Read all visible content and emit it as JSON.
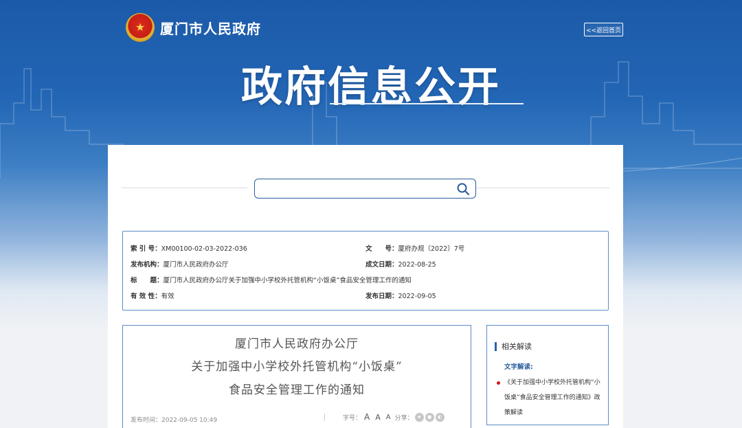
{
  "header": {
    "site_name": "厦门市人民政府",
    "home_link": "<<返回首页",
    "hero_title": "政府信息公开"
  },
  "search": {
    "value": "",
    "placeholder": ""
  },
  "meta": {
    "index_label": "索 引 号：",
    "index_value": "XM00100-02-03-2022-036",
    "doc_no_label": "文　　号：",
    "doc_no_value": "厦府办规〔2022〕7号",
    "issuer_label": "发布机构：",
    "issuer_value": "厦门市人民政府办公厅",
    "created_label": "成文日期：",
    "created_value": "2022-08-25",
    "title_label": "标　　题：",
    "title_value": "厦门市人民政府办公厅关于加强中小学校外托管机构“小饭桌”食品安全管理工作的通知",
    "validity_label": "有 效 性：",
    "validity_value": "有效",
    "published_label": "发布日期：",
    "published_value": "2022-09-05"
  },
  "article": {
    "title_line1": "厦门市人民政府办公厅",
    "title_line2": "关于加强中小学校外托管机构“小饭桌”",
    "title_line3": "食品安全管理工作的通知",
    "pubtime": "发布时间：2022-09-05 10:49",
    "font_size_label": "字号：",
    "font_large": "A",
    "font_medium": "A",
    "font_small": "A",
    "share_label": "分享："
  },
  "sidebar": {
    "heading": "相关解读",
    "sub_heading": "文字解读:",
    "link_text": "《关于加强中小学校外托管机构“小饭桌”食品安全管理工作的通知》政策解读"
  },
  "colors": {
    "brand_blue": "#1b5aa8",
    "border_blue": "#5b8ec7",
    "accent_red": "#d0161b"
  }
}
